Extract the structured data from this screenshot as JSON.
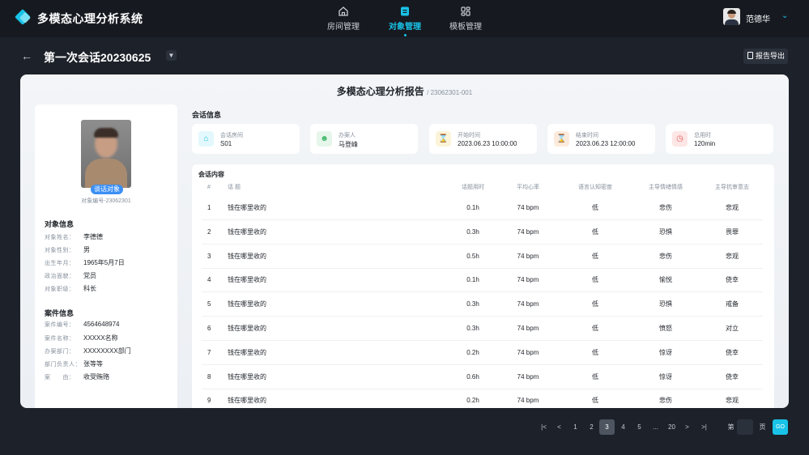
{
  "app": {
    "title": "多模态心理分析系统"
  },
  "nav": [
    {
      "label": "房间管理",
      "icon": "home-icon",
      "active": false
    },
    {
      "label": "对象管理",
      "icon": "document-icon",
      "active": true
    },
    {
      "label": "模板管理",
      "icon": "grid-icon",
      "active": false
    }
  ],
  "user": {
    "name": "范德华"
  },
  "session": {
    "title": "第一次会话20230625",
    "export_label": "报告导出"
  },
  "report": {
    "title": "多模态心理分析报告",
    "id": "/ 23062301-001"
  },
  "subject": {
    "photo_tag": "谈话对象",
    "number": "对象编号-23062301",
    "section_title": "对象信息",
    "fields": [
      {
        "key": "对象姓名：",
        "value": "李德德"
      },
      {
        "key": "对象性别：",
        "value": "男"
      },
      {
        "key": "出生年月：",
        "value": "1965年5月7日"
      },
      {
        "key": "政治面貌：",
        "value": "党员"
      },
      {
        "key": "对象职级：",
        "value": "科长"
      }
    ]
  },
  "case": {
    "section_title": "案件信息",
    "fields": [
      {
        "key": "案件编号：",
        "value": "4564648974"
      },
      {
        "key": "案件名称：",
        "value": "XXXXX名称"
      },
      {
        "key": "办案部门：",
        "value": "XXXXXXXX部门"
      },
      {
        "key": "部门负责人：",
        "value": "张等等"
      },
      {
        "key": "案　　由：",
        "value": "收受贿赂"
      }
    ]
  },
  "session_info": {
    "title": "会话信息",
    "tiles": [
      {
        "label": "会话房间",
        "value": "S01",
        "icon": "home-icon",
        "color": "#19c3e8",
        "bg": "#e3f8fc"
      },
      {
        "label": "办案人",
        "value": "马登峰",
        "icon": "user-icon",
        "color": "#3fb868",
        "bg": "#e6f6ea"
      },
      {
        "label": "开始时间",
        "value": "2023.06.23  10:00:00",
        "icon": "hourglass-icon",
        "color": "#e3b10c",
        "bg": "#fcf4d8"
      },
      {
        "label": "结束时间",
        "value": "2023.06.23  12:00:00",
        "icon": "hourglass-icon",
        "color": "#e6853a",
        "bg": "#fcebdc"
      },
      {
        "label": "总用时",
        "value": "120min",
        "icon": "clock-icon",
        "color": "#e65b5b",
        "bg": "#fde6e6"
      }
    ]
  },
  "content": {
    "title": "会话内容",
    "headers": [
      "#",
      "话 题",
      "话题用时",
      "平均心率",
      "语言认知密度",
      "主导情绪情感",
      "主导抗审意志"
    ],
    "rows": [
      [
        "1",
        "钱在哪里收的",
        "0.1h",
        "74 bpm",
        "低",
        "悲伤",
        "悲观"
      ],
      [
        "2",
        "钱在哪里收的",
        "0.3h",
        "74 bpm",
        "低",
        "恐惧",
        "畏罪"
      ],
      [
        "3",
        "钱在哪里收的",
        "0.5h",
        "74 bpm",
        "低",
        "悲伤",
        "悲观"
      ],
      [
        "4",
        "钱在哪里收的",
        "0.1h",
        "74 bpm",
        "低",
        "愉悦",
        "侥幸"
      ],
      [
        "5",
        "钱在哪里收的",
        "0.3h",
        "74 bpm",
        "低",
        "恐惧",
        "戒备"
      ],
      [
        "6",
        "钱在哪里收的",
        "0.3h",
        "74 bpm",
        "低",
        "愤怒",
        "对立"
      ],
      [
        "7",
        "钱在哪里收的",
        "0.2h",
        "74 bpm",
        "低",
        "惊讶",
        "侥幸"
      ],
      [
        "8",
        "钱在哪里收的",
        "0.6h",
        "74 bpm",
        "低",
        "惊讶",
        "侥幸"
      ],
      [
        "9",
        "钱在哪里收的",
        "0.2h",
        "74 bpm",
        "低",
        "悲伤",
        "悲观"
      ]
    ]
  },
  "pagination": {
    "first": "|<",
    "prev": "<",
    "pages": [
      "1",
      "2",
      "3",
      "4",
      "5",
      "...",
      "20"
    ],
    "current": "3",
    "next": ">",
    "last": ">|",
    "goto_prefix": "第",
    "goto_suffix": "页",
    "go_label": "GO"
  },
  "colors": {
    "accent": "#19c3e8",
    "bg": "#1d2129",
    "topbar": "#161a20"
  }
}
